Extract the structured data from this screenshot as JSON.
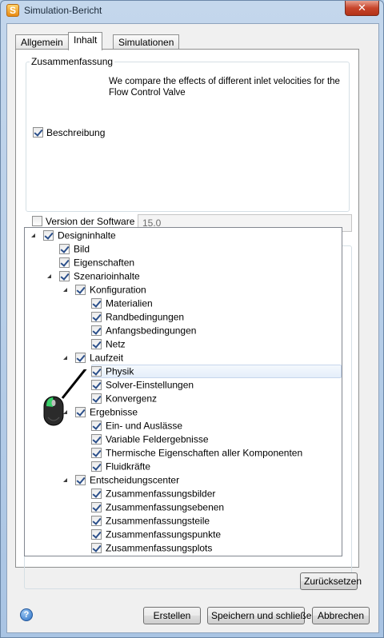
{
  "window": {
    "title": "Simulation-Bericht",
    "close_glyph": "✕"
  },
  "tabs": [
    {
      "label": "Allgemein",
      "active": false
    },
    {
      "label": "Inhalt",
      "active": true
    },
    {
      "label": "Simulationen",
      "active": false
    }
  ],
  "summary": {
    "legend": "Zusammenfassung",
    "description_text": "We compare the effects of different inlet velocities for the Flow Control Valve",
    "description_checkbox_label": "Beschreibung",
    "description_checked": true,
    "version_label": "Version der Software",
    "version_checked": false,
    "version_value": "15.0"
  },
  "tree": {
    "items": [
      {
        "label": "Designinhalte",
        "level": 0,
        "expanded": true,
        "checked": true
      },
      {
        "label": "Bild",
        "level": 1,
        "checked": true
      },
      {
        "label": "Eigenschaften",
        "level": 1,
        "checked": true
      },
      {
        "label": "Szenarioinhalte",
        "level": 1,
        "expanded": true,
        "checked": true
      },
      {
        "label": "Konfiguration",
        "level": 2,
        "expanded": true,
        "checked": true
      },
      {
        "label": "Materialien",
        "level": 3,
        "checked": true
      },
      {
        "label": "Randbedingungen",
        "level": 3,
        "checked": true
      },
      {
        "label": "Anfangsbedingungen",
        "level": 3,
        "checked": true
      },
      {
        "label": "Netz",
        "level": 3,
        "checked": true
      },
      {
        "label": "Laufzeit",
        "level": 2,
        "expanded": true,
        "checked": true
      },
      {
        "label": "Physik",
        "level": 3,
        "checked": true,
        "selected": true
      },
      {
        "label": "Solver-Einstellungen",
        "level": 3,
        "checked": true
      },
      {
        "label": "Konvergenz",
        "level": 3,
        "checked": true
      },
      {
        "label": "Ergebnisse",
        "level": 2,
        "expanded": true,
        "checked": true
      },
      {
        "label": "Ein- und Auslässe",
        "level": 3,
        "checked": true
      },
      {
        "label": "Variable Feldergebnisse",
        "level": 3,
        "checked": true
      },
      {
        "label": "Thermische Eigenschaften aller Komponenten",
        "level": 3,
        "checked": true
      },
      {
        "label": "Fluidkräfte",
        "level": 3,
        "checked": true
      },
      {
        "label": "Entscheidungscenter",
        "level": 2,
        "expanded": true,
        "checked": true
      },
      {
        "label": "Zusammenfassungsbilder",
        "level": 3,
        "checked": true
      },
      {
        "label": "Zusammenfassungsebenen",
        "level": 3,
        "checked": true
      },
      {
        "label": "Zusammenfassungsteile",
        "level": 3,
        "checked": true
      },
      {
        "label": "Zusammenfassungspunkte",
        "level": 3,
        "checked": true
      },
      {
        "label": "Zusammenfassungsplots",
        "level": 3,
        "checked": true
      }
    ]
  },
  "buttons": {
    "reset": "Zurücksetzen",
    "create": "Erstellen",
    "save_close": "Speichern und schließen",
    "cancel": "Abbrechen"
  },
  "icons": {
    "app": "simulation-app-icon",
    "help": "help-icon",
    "mouse": "mouse-icon",
    "help_glyph": "?",
    "app_glyph": "S"
  },
  "colors": {
    "mouse_button_highlight": "#3ad16a",
    "selection_border": "#c6d6ec",
    "close_button": "#c7452b"
  }
}
